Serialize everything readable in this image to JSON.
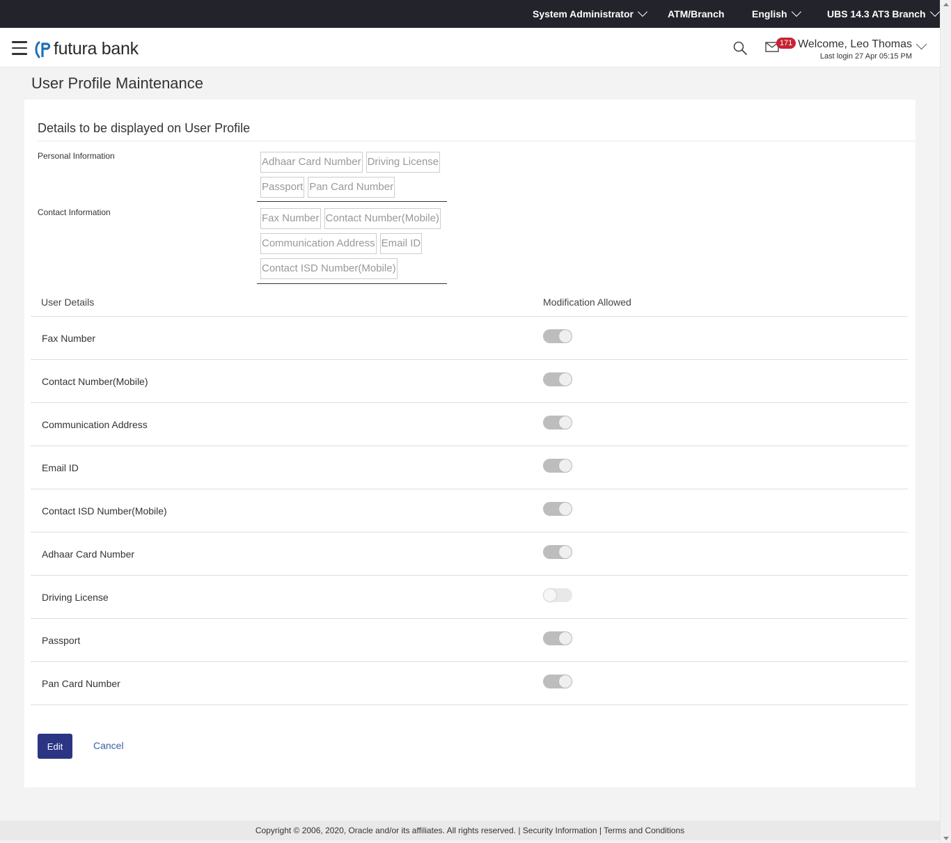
{
  "topbar": {
    "role": "System Administrator",
    "atm_branch": "ATM/Branch",
    "language": "English",
    "branch": "UBS 14.3 AT3 Branch"
  },
  "header": {
    "logo_text": "futura bank",
    "notification_count": "171",
    "welcome": "Welcome, Leo Thomas",
    "last_login": "Last login 27 Apr 05:15 PM"
  },
  "page": {
    "title": "User Profile Maintenance"
  },
  "details": {
    "title": "Details to be displayed on User Profile",
    "personal_label": "Personal Information",
    "personal_chips": [
      "Adhaar Card Number",
      "Driving License",
      "Passport",
      "Pan Card Number"
    ],
    "contact_label": "Contact Information",
    "contact_chips": [
      "Fax Number",
      "Contact Number(Mobile)",
      "Communication Address",
      "Email ID",
      "Contact ISD Number(Mobile)"
    ]
  },
  "table": {
    "col_user_details": "User Details",
    "col_modification": "Modification Allowed",
    "rows": [
      {
        "label": "Fax Number",
        "allowed": true
      },
      {
        "label": "Contact Number(Mobile)",
        "allowed": true
      },
      {
        "label": "Communication Address",
        "allowed": true
      },
      {
        "label": "Email ID",
        "allowed": true
      },
      {
        "label": "Contact ISD Number(Mobile)",
        "allowed": true
      },
      {
        "label": "Adhaar Card Number",
        "allowed": true
      },
      {
        "label": "Driving License",
        "allowed": false
      },
      {
        "label": "Passport",
        "allowed": true
      },
      {
        "label": "Pan Card Number",
        "allowed": true
      }
    ]
  },
  "actions": {
    "edit": "Edit",
    "cancel": "Cancel"
  },
  "footer": {
    "copyright": "Copyright © 2006, 2020, Oracle and/or its affiliates. All rights reserved.",
    "security": "Security Information",
    "terms": "Terms and Conditions"
  },
  "colors": {
    "topbar": "#23232b",
    "primary_button": "#2b3584",
    "badge": "#c82333",
    "link": "#3a5fa8"
  }
}
